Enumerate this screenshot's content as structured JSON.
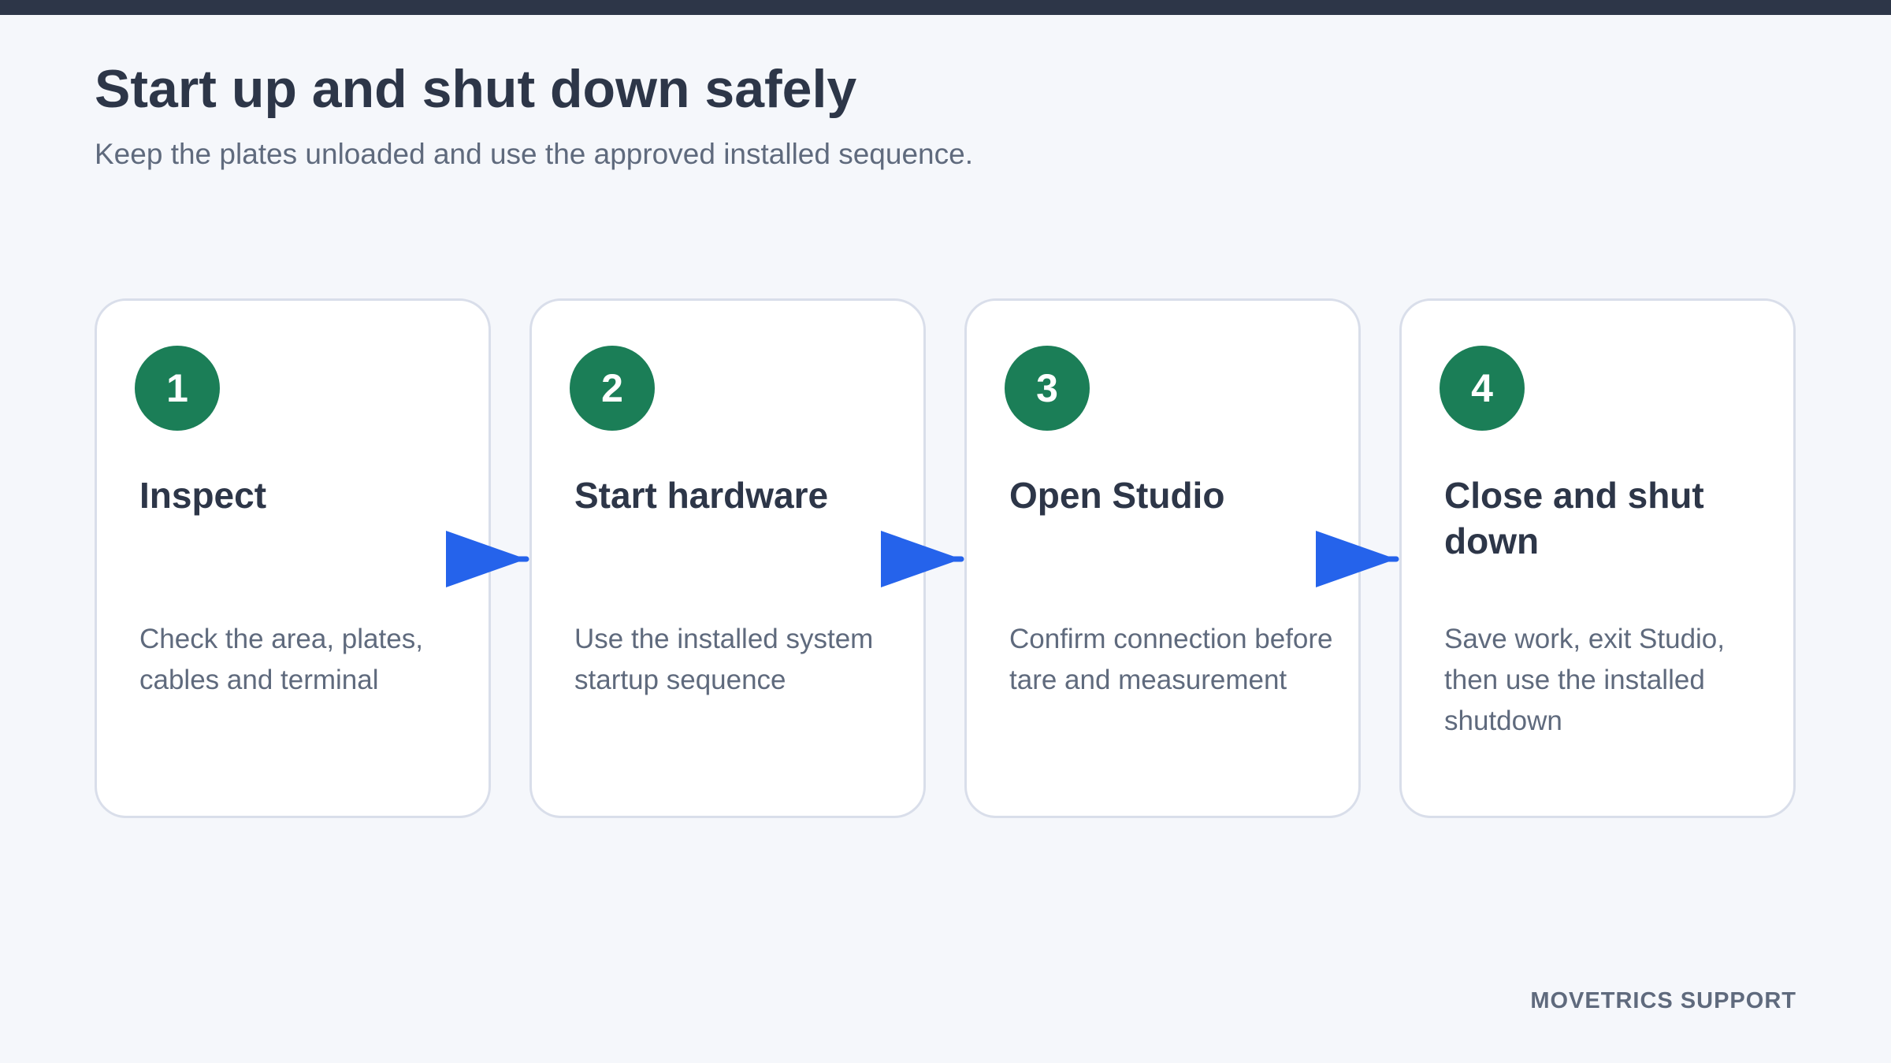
{
  "header": {
    "title": "Start up and shut down safely",
    "subtitle": "Keep the plates unloaded and use the approved installed sequence."
  },
  "steps": [
    {
      "number": "1",
      "title": "Inspect",
      "description": "Check the area, plates, cables and terminal"
    },
    {
      "number": "2",
      "title": "Start hardware",
      "description": "Use the installed system startup sequence"
    },
    {
      "number": "3",
      "title": "Open Studio",
      "description": "Confirm connection before tare and measurement"
    },
    {
      "number": "4",
      "title": "Close and shut down",
      "description": "Save work, exit Studio, then use the installed shutdown"
    }
  ],
  "footer": {
    "brand": "MOVETRICS SUPPORT"
  },
  "colors": {
    "top_bar": "#2d3648",
    "badge": "#1b7e57",
    "arrow": "#2563eb",
    "card_border": "#d9deea"
  }
}
